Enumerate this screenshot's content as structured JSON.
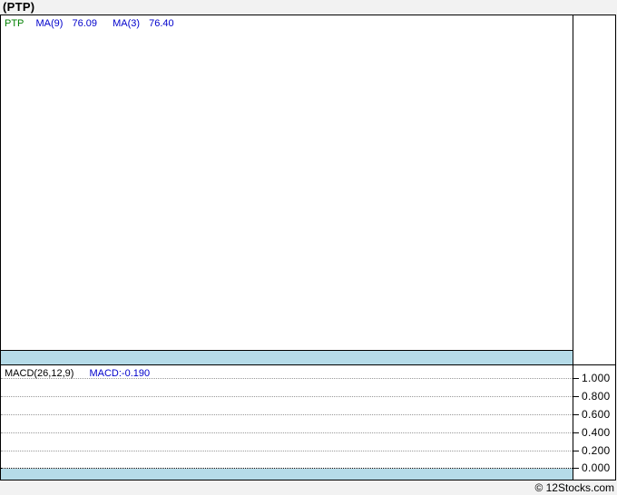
{
  "title": "(PTP)",
  "price_panel": {
    "symbol": "PTP",
    "ma9_label": "MA(9)",
    "ma9_value": "76.09",
    "ma3_label": "MA(3)",
    "ma3_value": "76.40"
  },
  "macd_panel": {
    "label": "MACD(26,12,9)",
    "value_label": "MACD:-0.190"
  },
  "macd_axis": {
    "labels": [
      "1.000",
      "0.800",
      "0.600",
      "0.400",
      "0.200",
      "0.000"
    ]
  },
  "footer": {
    "credit": "© 12Stocks.com"
  },
  "colors": {
    "symbol_green": "#008000",
    "indicator_blue": "#0000cc",
    "separator_band_blue": "#b5dbe8",
    "gridline_gray": "#999999",
    "border_black": "#000000",
    "page_background": "#f2f2f2"
  },
  "chart_data": [
    {
      "type": "line",
      "panel": "price",
      "title": "(PTP)",
      "legend": [
        "PTP",
        "MA(9) 76.09",
        "MA(3) 76.40"
      ],
      "indicators": {
        "MA(9)": 76.09,
        "MA(3)": 76.4
      },
      "series": [],
      "note": "price panel is empty - no plotted data visible",
      "grid": "off",
      "legend_position": "top-left"
    },
    {
      "type": "line",
      "panel": "MACD",
      "legend": [
        "MACD(26,12,9)",
        "MACD:-0.190"
      ],
      "macd_value": -0.19,
      "ylim": [
        0.0,
        1.0
      ],
      "yticks": [
        1.0,
        0.8,
        0.6,
        0.4,
        0.2,
        0.0
      ],
      "yaxis_side": "right",
      "series": [],
      "note": "MACD panel shows only dotted horizontal gridlines - no plotted data visible",
      "grid": "horizontal-dotted",
      "legend_position": "top-left"
    }
  ]
}
